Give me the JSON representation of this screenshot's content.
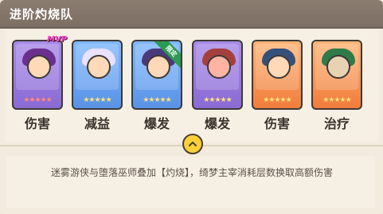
{
  "header": {
    "title": "进阶灼烧队"
  },
  "team": [
    {
      "role": "伤害",
      "rarity_color": "purple",
      "stars": "★★★★★",
      "star_style": "red",
      "badge": "MVP"
    },
    {
      "role": "减益",
      "rarity_color": "blue",
      "stars": "★★★★★",
      "star_style": "gold"
    },
    {
      "role": "爆发",
      "rarity_color": "blue",
      "stars": "★★★★★",
      "star_style": "gold",
      "ribbon": "限定"
    },
    {
      "role": "爆发",
      "rarity_color": "purple",
      "stars": "★★★★★",
      "star_style": "gold"
    },
    {
      "role": "伤害",
      "rarity_color": "orange",
      "stars": "★★★★★",
      "star_style": "gold"
    },
    {
      "role": "治疗",
      "rarity_color": "orange",
      "stars": "★★★★★",
      "star_style": "gold"
    }
  ],
  "description": "迷雾游侠与堕落巫师叠加【灼烧】，绮梦主宰消耗层数换取高额伤害",
  "colors": {
    "header_bg": "#847568",
    "panel_bg": "#f3ecde",
    "expand_button": "#ffcf3a"
  }
}
